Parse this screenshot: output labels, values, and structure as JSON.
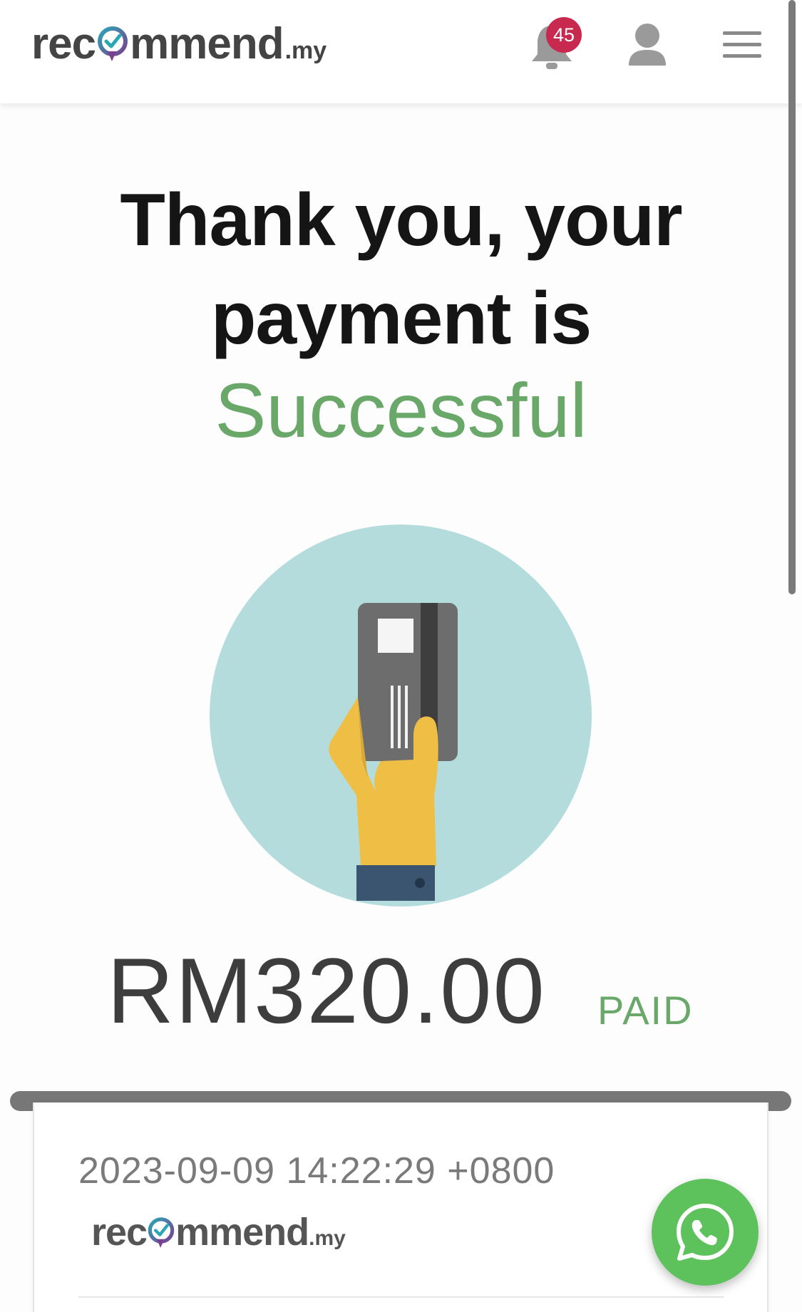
{
  "header": {
    "logo": {
      "word_start": "rec",
      "word_end": "mmend",
      "tld": ".my"
    },
    "notifications": {
      "count": "45",
      "icon": "bell-icon"
    },
    "user_icon": "user-icon",
    "menu_icon": "hamburger-menu-icon"
  },
  "main": {
    "headline_line1": "Thank you, your",
    "headline_line2": "payment is",
    "status_word": "Successful",
    "illustration_icon": "hand-holding-card-icon",
    "amount": "RM320.00",
    "amount_status": "PAID"
  },
  "receipt": {
    "timestamp": "2023-09-09 14:22:29 +0800",
    "logo": {
      "word_start": "rec",
      "word_end": "mmend",
      "tld": ".my"
    }
  },
  "floating": {
    "whatsapp_icon": "whatsapp-icon"
  },
  "colors": {
    "success_green": "#69a869",
    "badge_red": "#c8294f",
    "whatsapp_green": "#5dc15c",
    "illustration_circle": "#b4dcdd",
    "logo_purple": "#7a3f8f",
    "logo_teal": "#2aa6b5"
  }
}
